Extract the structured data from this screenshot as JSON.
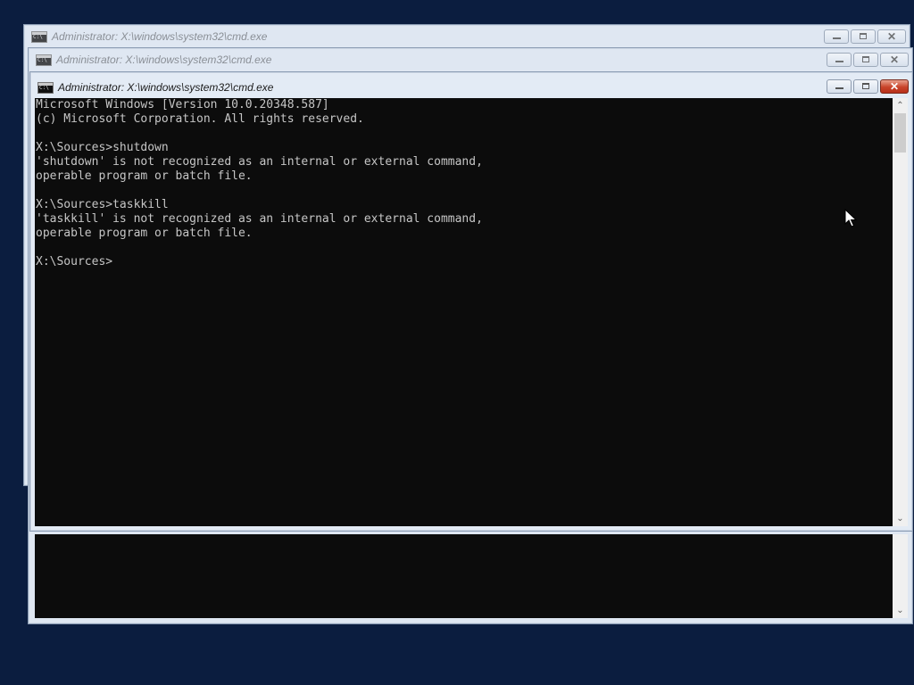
{
  "windows": [
    {
      "title": "Administrator: X:\\windows\\system32\\cmd.exe",
      "state": "inactive"
    },
    {
      "title": "Administrator: X:\\windows\\system32\\cmd.exe",
      "state": "inactive"
    },
    {
      "title": "Administrator: X:\\windows\\system32\\cmd.exe",
      "state": "active",
      "console_lines": [
        "Microsoft Windows [Version 10.0.20348.587]",
        "(c) Microsoft Corporation. All rights reserved.",
        "",
        "X:\\Sources>shutdown",
        "'shutdown' is not recognized as an internal or external command,",
        "operable program or batch file.",
        "",
        "X:\\Sources>taskkill",
        "'taskkill' is not recognized as an internal or external command,",
        "operable program or batch file.",
        "",
        "X:\\Sources>"
      ]
    }
  ],
  "colors": {
    "desktop": "#0b1d3f",
    "console_bg": "#0c0c0c",
    "console_fg": "#c6c6c6",
    "close_active": "#c8432a"
  },
  "icons": {
    "window_icon": "cmd-icon",
    "minimize": "minimize-icon",
    "maximize": "maximize-icon",
    "close": "close-icon",
    "scroll_up": "chevron-up-icon",
    "scroll_down": "chevron-down-icon",
    "pointer": "mouse-pointer-icon"
  }
}
